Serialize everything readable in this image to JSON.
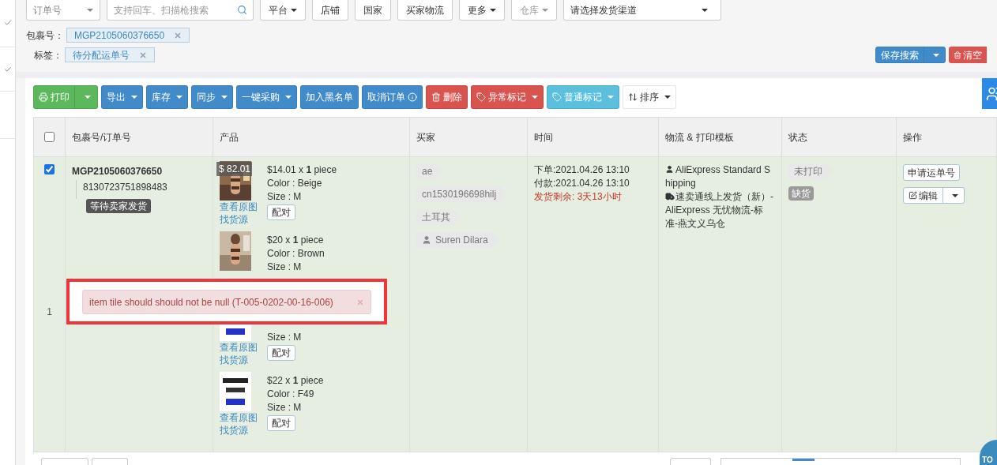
{
  "filters": {
    "order_select": "订单号",
    "search": {
      "placeholder": "支持回车、扫描枪搜索"
    },
    "buttons": [
      {
        "label": "平台",
        "dropdown": true,
        "disabled": false
      },
      {
        "label": "店铺",
        "dropdown": false,
        "disabled": false
      },
      {
        "label": "国家",
        "dropdown": false,
        "disabled": false
      },
      {
        "label": "买家物流",
        "dropdown": false,
        "disabled": false
      },
      {
        "label": "更多",
        "dropdown": true,
        "disabled": false
      },
      {
        "label": "仓库",
        "dropdown": true,
        "disabled": true
      }
    ],
    "channel_select": "请选择发货渠道"
  },
  "active_filters": [
    {
      "label": "包裹号：",
      "value": "MGP2105060376650"
    },
    {
      "label": "标签：",
      "value": "待分配运单号"
    }
  ],
  "save_search": "保存搜索",
  "clear": "清空",
  "toolbar": [
    {
      "label": "打印",
      "kind": "split",
      "color": "#5cb85c"
    },
    {
      "label": "导出",
      "kind": "dropdown",
      "color": "#428bca"
    },
    {
      "label": "库存",
      "kind": "dropdown",
      "color": "#428bca"
    },
    {
      "label": "同步",
      "kind": "dropdown",
      "color": "#428bca"
    },
    {
      "label": "一键采购",
      "kind": "dropdown",
      "color": "#428bca"
    },
    {
      "label": "加入黑名单",
      "kind": "plain",
      "color": "#428bca"
    },
    {
      "label": "取消订单",
      "kind": "plain",
      "color": "#428bca"
    },
    {
      "label": "删除",
      "kind": "plain",
      "color": "#d9534f"
    },
    {
      "label": "异常标记",
      "kind": "dropdown",
      "color": "#d9534f"
    },
    {
      "label": "普通标记",
      "kind": "dropdown",
      "color": "#5bc0de"
    },
    {
      "label": "排序",
      "kind": "dropdown",
      "color": "#ffffff"
    }
  ],
  "table": {
    "select_all": {
      "checked": false
    },
    "columns": [
      "包裹号/订单号",
      "产品",
      "买家",
      "时间",
      "物流 & 打印模板",
      "状态",
      "操作"
    ],
    "rows": [
      {
        "selected": true,
        "checked": true,
        "row_number": "1",
        "package": "MGP2105060376650",
        "order": "8130723751898483",
        "order_status": "等待卖家发货",
        "total": "$ 82.01",
        "products": [
          {
            "line": "$14.01 x **1** piece",
            "variant": "Color : Beige",
            "size": "Size : M",
            "links": [
              "查看原图",
              "找货源"
            ],
            "match": "配对"
          },
          {
            "line": "$20 x **1** piece",
            "variant": "Color : Brown",
            "size": "Size : M"
          },
          {
            "size": "Size : M",
            "links": [
              "查看原图",
              "找货源"
            ],
            "match": "配对"
          },
          {
            "line": "$22 x **1** piece",
            "variant": "Color : F49",
            "size": "Size : M",
            "links": [
              "查看原图",
              "找货源"
            ],
            "match": "配对"
          }
        ],
        "buyer": [
          {
            "kind": "tag",
            "text": "ae"
          },
          {
            "kind": "tag",
            "text": "cn1530196698hilj"
          },
          {
            "kind": "tag",
            "text": "土耳其"
          },
          {
            "kind": "person",
            "text": "Suren Dilara"
          }
        ],
        "time": [
          {
            "kind": "normal",
            "text": "下单:2021.04.26 13:10"
          },
          {
            "kind": "normal",
            "text": "付款:2021.04.26 13:10"
          },
          {
            "kind": "warning",
            "text": "发货剩余: 3天13小时"
          }
        ],
        "logistics": [
          {
            "kind": "person",
            "text": "AliExpress Standard Shipping"
          },
          {
            "kind": "truck",
            "text": "速卖通线上发货（新）- AliExpress 无忧物流-标准-燕文义乌仓"
          }
        ],
        "status": [
          {
            "kind": "tag",
            "text": "未打印"
          },
          {
            "kind": "badge",
            "text": "缺货"
          }
        ],
        "actions": [
          {
            "kind": "button",
            "label": "申请运单号"
          },
          {
            "kind": "split",
            "label": "编辑"
          }
        ]
      }
    ]
  },
  "toast": {
    "message": "item tile should should not be null (T-005-0202-00-16-006)"
  },
  "scroll_top": "TO"
}
